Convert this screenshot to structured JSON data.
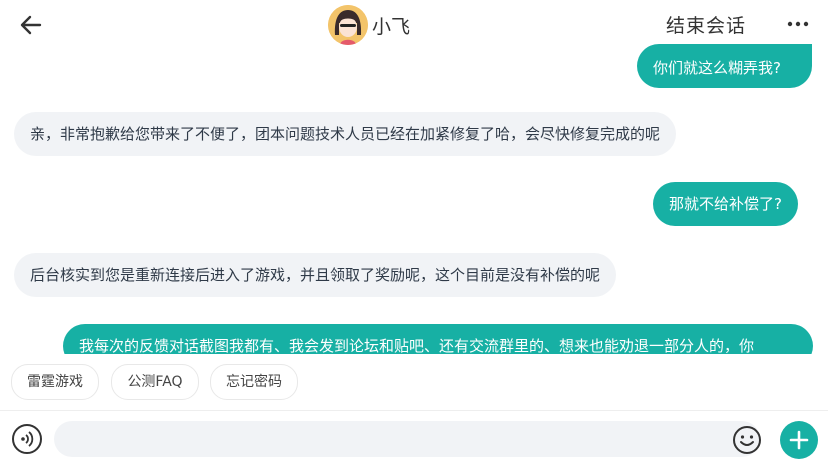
{
  "header": {
    "agent_name": "小飞",
    "end_chat_label": "结束会话",
    "icons": {
      "back": "back-arrow-icon",
      "more": "more-dots-icon"
    }
  },
  "messages": [
    {
      "from": "user",
      "text": "你们就这么糊弄我?"
    },
    {
      "from": "agent",
      "text": "亲，非常抱歉给您带来了不便了，团本问题技术人员已经在加紧修复了哈，会尽快修复完成的呢"
    },
    {
      "from": "user",
      "text": "那就不给补偿了?"
    },
    {
      "from": "agent",
      "text": "后台核实到您是重新连接后进入了游戏，并且领取了奖励呢，这个目前是没有补偿的呢"
    },
    {
      "from": "user",
      "text": "我每次的反馈对话截图我都有、我会发到论坛和贴吧、还有交流群里的、想来也能劝退一部分人的，你"
    }
  ],
  "quick_replies": [
    "雷霆游戏",
    "公测FAQ",
    "忘记密码"
  ],
  "input": {
    "value": "",
    "placeholder": ""
  },
  "colors": {
    "accent": "#17b0a4",
    "agent_bubble": "#f1f3f6"
  }
}
